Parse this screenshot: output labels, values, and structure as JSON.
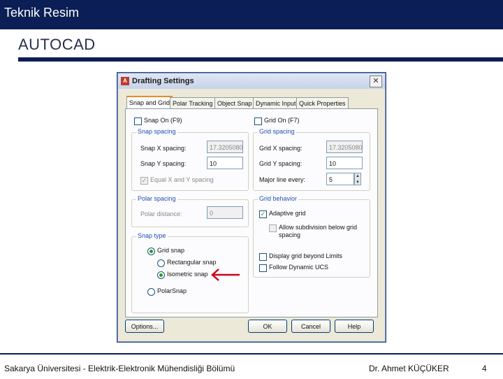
{
  "header": {
    "title": "Teknik Resim"
  },
  "subtitle": "AUTOCAD",
  "footer": {
    "university": "Sakarya Üniversitesi - Elektrik-Elektronik Mühendisliği Bölümü",
    "author": "Dr. Ahmet KÜÇÜKER",
    "page": "4"
  },
  "dialog": {
    "title": "Drafting Settings",
    "app_icon_label": "A",
    "close_glyph": "✕",
    "tabs": [
      "Snap and Grid",
      "Polar Tracking",
      "Object Snap",
      "Dynamic Input",
      "Quick Properties"
    ],
    "snap_on": {
      "label": "Snap On (F9)",
      "checked": false
    },
    "grid_on": {
      "label": "Grid On (F7)",
      "checked": false
    },
    "snap_spacing": {
      "legend": "Snap spacing",
      "x_label": "Snap X spacing:",
      "x_value": "17.3205080",
      "y_label": "Snap Y spacing:",
      "y_value": "10",
      "equal_label": "Equal X and Y spacing",
      "equal_checked": true
    },
    "polar_spacing": {
      "legend": "Polar spacing",
      "distance_label": "Polar distance:",
      "distance_value": "0"
    },
    "snap_type": {
      "legend": "Snap type",
      "grid_snap": "Grid snap",
      "rectangular": "Rectangular snap",
      "isometric": "Isometric snap",
      "polar": "PolarSnap",
      "selected": "isometric"
    },
    "grid_spacing": {
      "legend": "Grid spacing",
      "x_label": "Grid X spacing:",
      "x_value": "17.3205080",
      "y_label": "Grid Y spacing:",
      "y_value": "10",
      "major_label": "Major line every:",
      "major_value": "5"
    },
    "grid_behavior": {
      "legend": "Grid behavior",
      "adaptive": "Adaptive grid",
      "adaptive_checked": true,
      "subdivision_line1": "Allow subdivision below grid",
      "subdivision_line2": "spacing",
      "beyond_limits": "Display grid beyond Limits",
      "follow_ucs": "Follow Dynamic UCS"
    },
    "buttons": {
      "options": "Options...",
      "ok": "OK",
      "cancel": "Cancel",
      "help": "Help"
    },
    "check_glyph": "✓",
    "spin_up": "▲",
    "spin_down": "▼"
  },
  "colors": {
    "header_bg": "#0b1e55",
    "annotation_arrow": "#d0021b"
  }
}
